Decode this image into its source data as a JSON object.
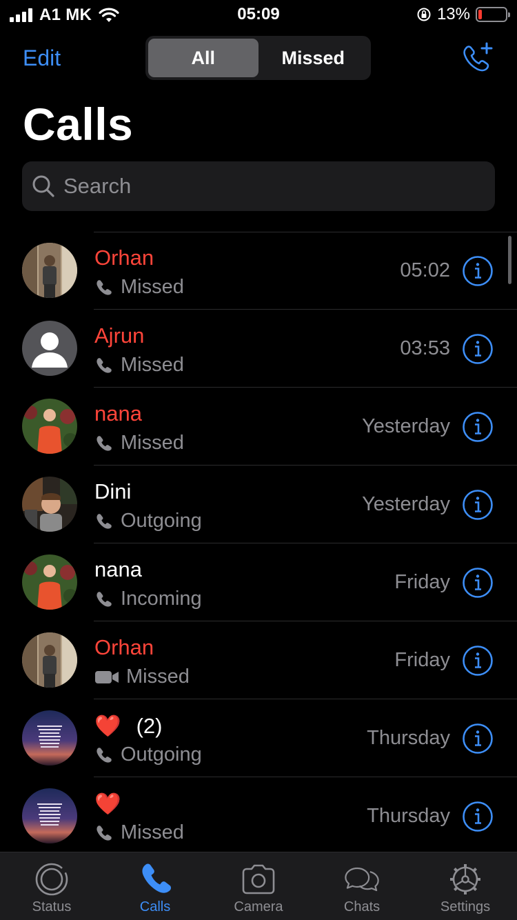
{
  "status_bar": {
    "carrier": "A1 MK",
    "time": "05:09",
    "battery_percent": "13%",
    "battery_level": 0.13
  },
  "nav": {
    "edit_label": "Edit",
    "segments": [
      "All",
      "Missed"
    ],
    "active_segment": "All",
    "new_call_icon": "phone-plus-icon"
  },
  "page_title": "Calls",
  "search": {
    "placeholder": "Search"
  },
  "calls": [
    {
      "name": "Orhan",
      "status": "Missed",
      "call_type": "voice",
      "time": "05:02",
      "missed": true
    },
    {
      "name": "Ajrun",
      "status": "Missed",
      "call_type": "voice",
      "time": "03:53",
      "missed": true
    },
    {
      "name": "nana",
      "status": "Missed",
      "call_type": "voice",
      "time": "Yesterday",
      "missed": true
    },
    {
      "name": "Dini",
      "status": "Outgoing",
      "call_type": "voice",
      "time": "Yesterday",
      "missed": false
    },
    {
      "name": "nana",
      "status": "Incoming",
      "call_type": "voice",
      "time": "Friday",
      "missed": false
    },
    {
      "name": "Orhan",
      "status": "Missed",
      "call_type": "video",
      "time": "Friday",
      "missed": true
    },
    {
      "name": "❤️",
      "count": "(2)",
      "status": "Outgoing",
      "call_type": "voice",
      "time": "Thursday",
      "missed": false
    },
    {
      "name": "❤️",
      "status": "Missed",
      "call_type": "voice",
      "time": "Thursday",
      "missed": false
    }
  ],
  "tab_bar": {
    "items": [
      {
        "label": "Status",
        "icon": "status-ring-icon"
      },
      {
        "label": "Calls",
        "icon": "phone-icon"
      },
      {
        "label": "Camera",
        "icon": "camera-icon"
      },
      {
        "label": "Chats",
        "icon": "chat-bubbles-icon"
      },
      {
        "label": "Settings",
        "icon": "gear-icon"
      }
    ],
    "active": "Calls"
  },
  "colors": {
    "accent": "#3d8ef7",
    "missed": "#ff453a",
    "secondary_text": "#8e8e93",
    "background": "#000000"
  }
}
